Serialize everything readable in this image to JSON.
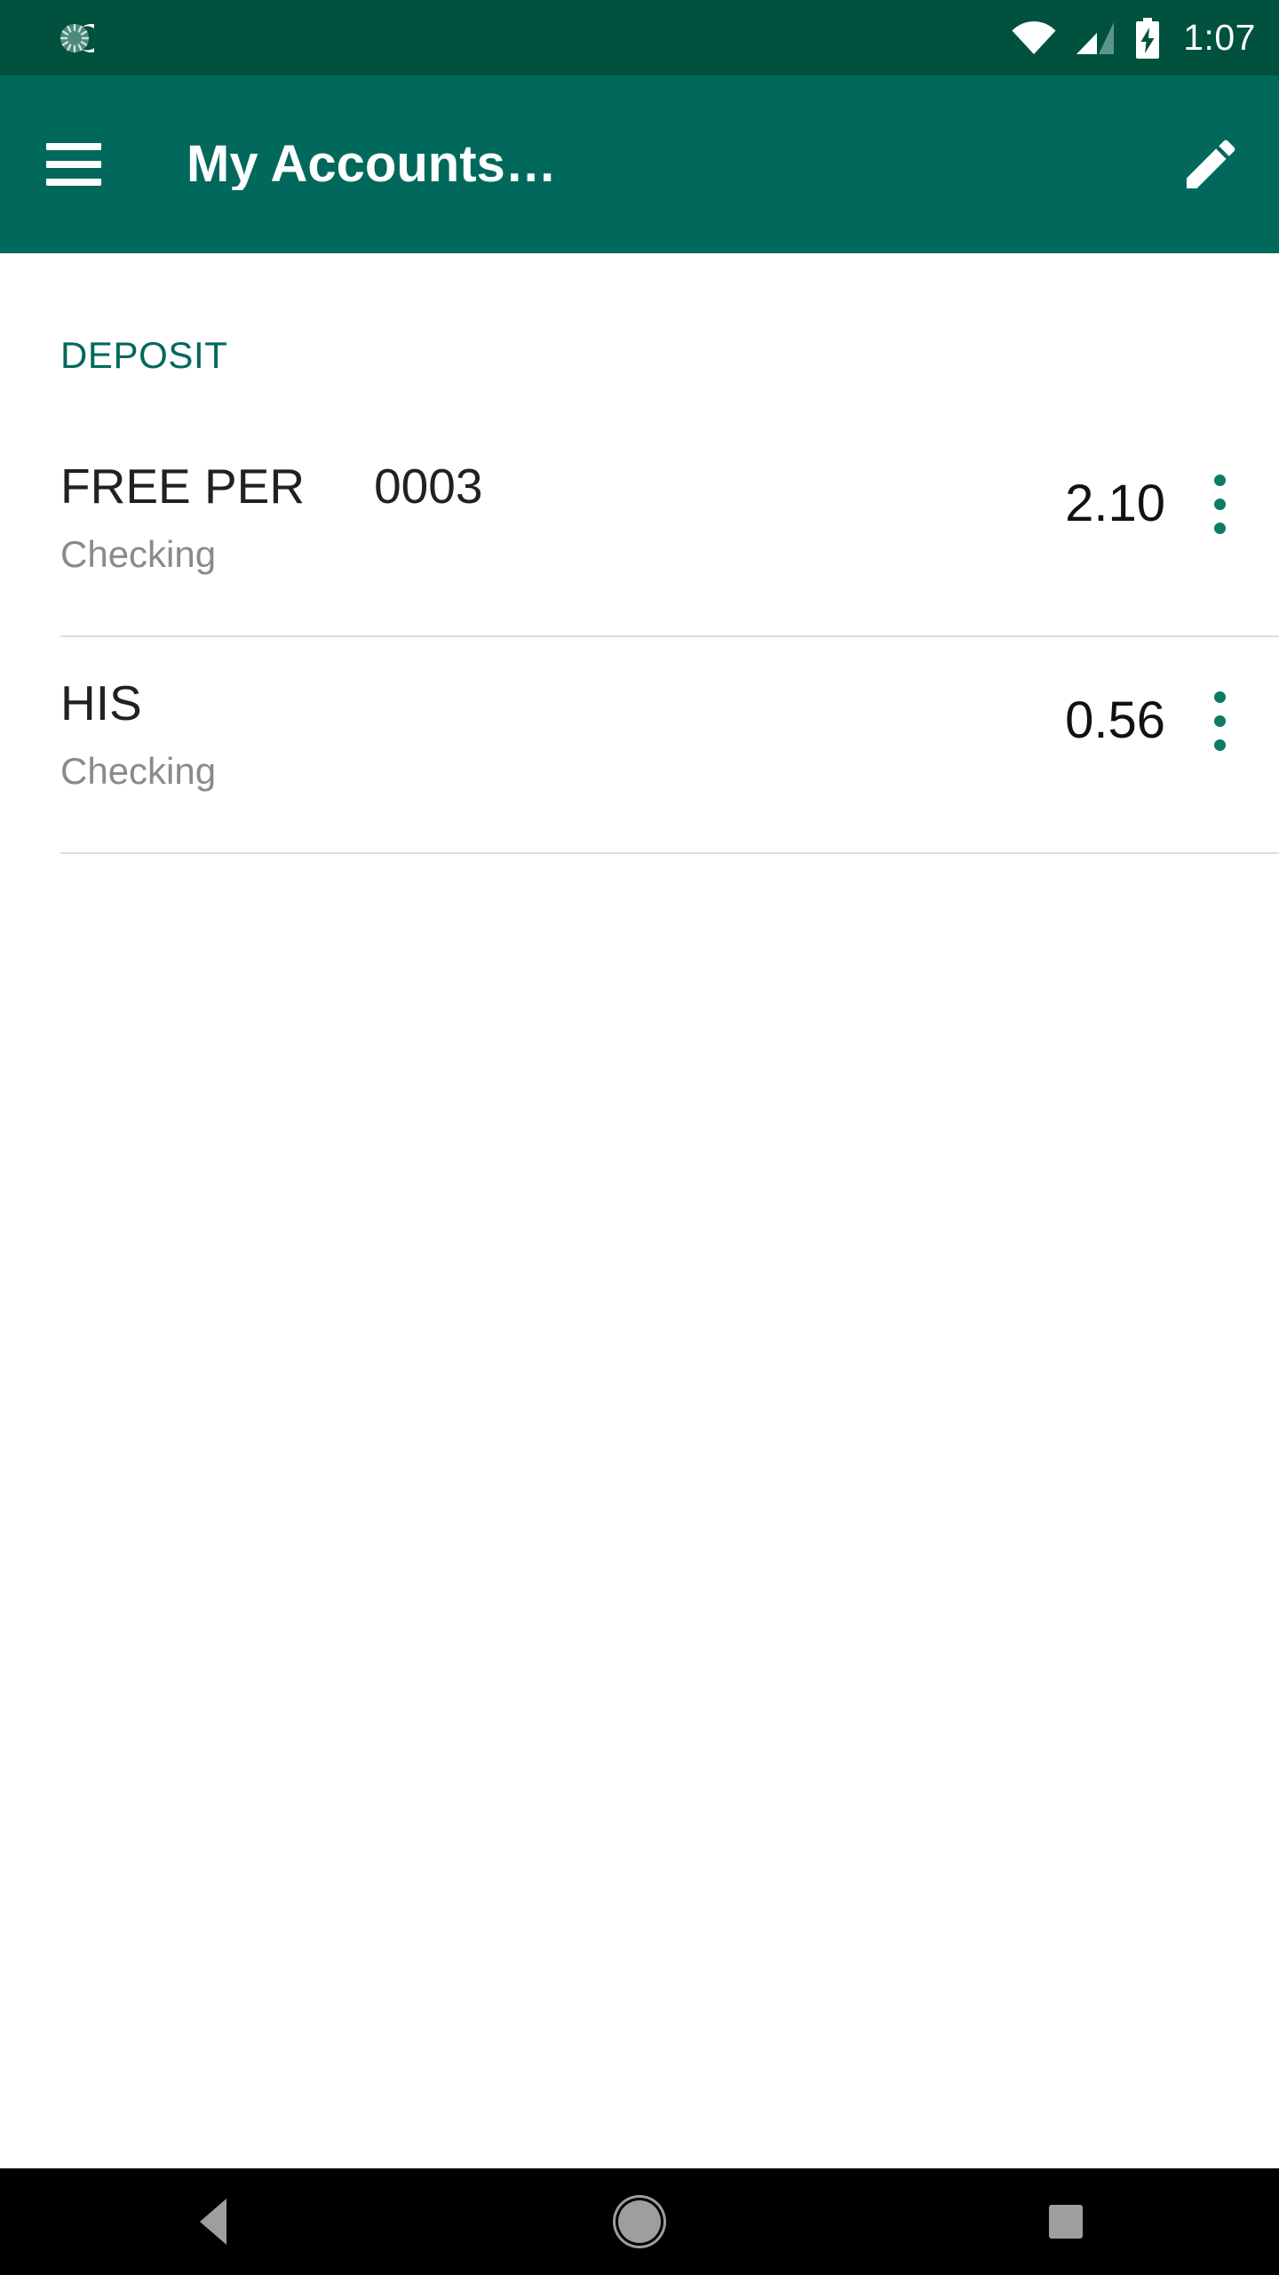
{
  "status_bar": {
    "background_color": "#00513D",
    "notification_icon": "sync-icon",
    "wifi_icon": "wifi-icon",
    "signal_icon": "cellular-signal-icon",
    "battery_icon": "battery-charging-icon",
    "time": "1:07"
  },
  "app_bar": {
    "background_color": "#00695C",
    "menu_icon": "hamburger-menu-icon",
    "title": "My Accounts…",
    "action_icon": "edit-pencil-icon"
  },
  "content": {
    "section_header": "DEPOSIT",
    "section_header_color": "#00695C",
    "accounts": [
      {
        "name": "FREE PER",
        "number": "0003",
        "type": "Checking",
        "balance": "2.10",
        "overflow_icon": "overflow-menu-icon"
      },
      {
        "name": "HIS",
        "number": "",
        "type": "Checking",
        "balance": "0.56",
        "overflow_icon": "overflow-menu-icon"
      }
    ]
  },
  "nav_bar": {
    "background_color": "#000000",
    "back_icon": "back-triangle-icon",
    "home_icon": "home-circle-icon",
    "recents_icon": "recents-square-icon"
  }
}
